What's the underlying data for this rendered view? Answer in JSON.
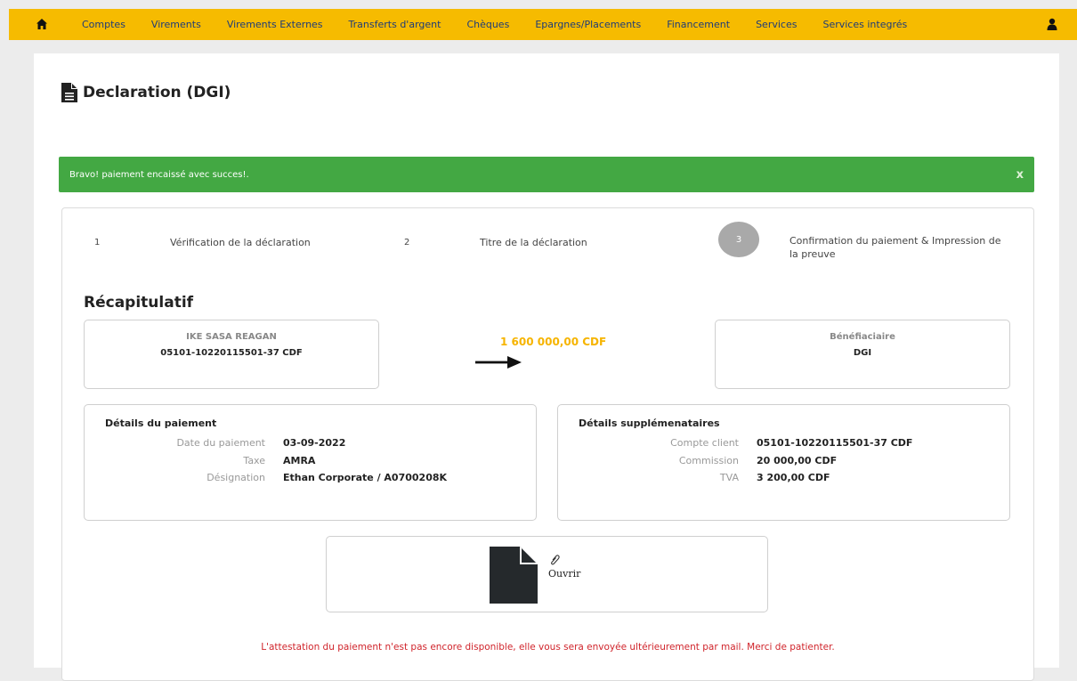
{
  "nav": {
    "home_icon": "home-icon",
    "items": [
      "Comptes",
      "Virements",
      "Virements Externes",
      "Transferts d'argent",
      "Chèques",
      "Epargnes/Placements",
      "Financement",
      "Services",
      "Services integrés"
    ],
    "user_icon": "user-icon",
    "bg_color": "#f6bb00",
    "text_color": "#1d3b79"
  },
  "page": {
    "title": "Declaration (DGI)",
    "title_icon": "document-icon"
  },
  "alert": {
    "message": "Bravo! paiement encaissé avec succes!.",
    "close": "x",
    "color": "#43a843"
  },
  "steps": [
    {
      "number": "1",
      "label": "Vérification de la déclaration"
    },
    {
      "number": "2",
      "label": "Titre de la déclaration"
    },
    {
      "number": "3",
      "label": "Confirmation du paiement & Impression de la preuve",
      "active": true
    }
  ],
  "recap": {
    "title": "Récapitulatif",
    "sender": {
      "name": "IKE SASA REAGAN",
      "account": "05101-10220115501-37 CDF"
    },
    "amount": "1 600 000,00 CDF",
    "beneficiary": {
      "label": "Bénéfiaciaire",
      "name": "DGI"
    },
    "accent_color": "#f6b400"
  },
  "payment_details": {
    "title": "Détails du paiement",
    "rows": [
      {
        "label": "Date du paiement",
        "value": "03-09-2022"
      },
      {
        "label": "Taxe",
        "value": "AMRA"
      },
      {
        "label": "Désignation",
        "value": "Ethan Corporate / A0700208K"
      }
    ]
  },
  "extra_details": {
    "title": "Détails supplémenataires",
    "rows": [
      {
        "label": "Compte client",
        "value": "05101-10220115501-37 CDF"
      },
      {
        "label": "Commission",
        "value": "20 000,00 CDF"
      },
      {
        "label": "TVA",
        "value": "3 200,00 CDF"
      }
    ]
  },
  "file": {
    "icon": "file-icon",
    "clip_icon": "paperclip-icon",
    "open_label": "Ouvrir"
  },
  "notice": {
    "text": "L'attestation du paiement n'est pas encore disponible, elle vous sera envoyée ultérieurement par mail. Merci de patienter.",
    "color": "#d0242b"
  }
}
